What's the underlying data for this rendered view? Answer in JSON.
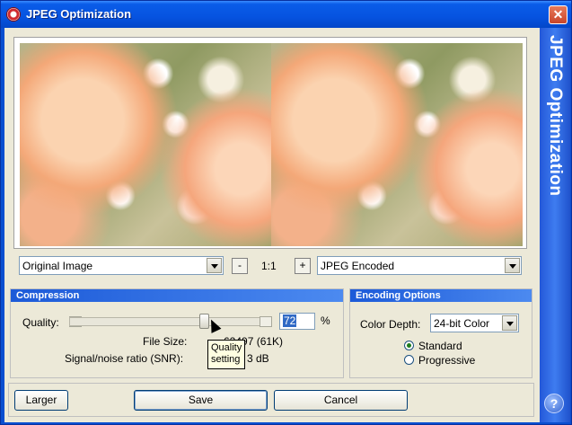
{
  "window": {
    "title": "JPEG Optimization",
    "close_glyph": "✕",
    "side_banner": "JPEG Optimization",
    "help_glyph": "?"
  },
  "preview": {
    "left_view": "Original Image",
    "right_view": "JPEG Encoded",
    "zoom_out": "-",
    "zoom_in": "+",
    "zoom_level": "1:1"
  },
  "compression": {
    "header": "Compression",
    "quality_label": "Quality:",
    "quality_value": "72",
    "quality_unit": "%",
    "quality_fraction": 0.72,
    "file_size_label": "File Size:",
    "file_size_value": "62497 (61K)",
    "snr_label": "Signal/noise ratio (SNR):",
    "snr_value": "3 dB",
    "tooltip": "Quality setting"
  },
  "encoding": {
    "header": "Encoding Options",
    "color_depth_label": "Color Depth:",
    "color_depth_value": "24-bit Color",
    "options": [
      "Standard",
      "Progressive"
    ],
    "selected": "Standard"
  },
  "buttons": {
    "larger": "Larger",
    "save": "Save",
    "cancel": "Cancel"
  },
  "icons": {
    "app": "app-logo-icon",
    "help": "help-icon",
    "close": "close-icon"
  }
}
